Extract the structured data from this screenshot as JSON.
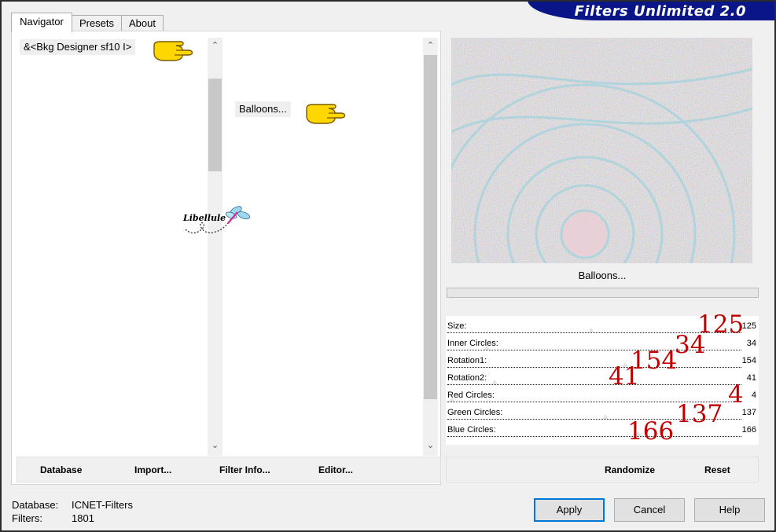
{
  "tabs": [
    "Navigator",
    "Presets",
    "About"
  ],
  "brand": "Filters Unlimited 2.0",
  "category_list": {
    "selected": "&<Bkg Designer sf10 I>"
  },
  "filter_list": {
    "selected": "Balloons..."
  },
  "watermark": "Libellule",
  "preview": {
    "filter_name": "Balloons..."
  },
  "parameters": [
    {
      "label": "Size:",
      "value": "125",
      "annotation": "125",
      "level": 125
    },
    {
      "label": "Inner Circles:",
      "value": "34",
      "annotation": "34",
      "level": 34
    },
    {
      "label": "Rotation1:",
      "value": "154",
      "annotation": "154",
      "level": 154
    },
    {
      "label": "Rotation2:",
      "value": "41",
      "annotation": "41",
      "level": 41
    },
    {
      "label": "Red Circles:",
      "value": "4",
      "annotation": "4",
      "level": 4
    },
    {
      "label": "Green Circles:",
      "value": "137",
      "annotation": "137",
      "level": 137
    },
    {
      "label": "Blue Circles:",
      "value": "166",
      "annotation": "166",
      "level": 166
    }
  ],
  "nav_buttons": {
    "database": "Database",
    "import": "Import...",
    "filter_info": "Filter Info...",
    "editor": "Editor..."
  },
  "param_buttons": {
    "randomize": "Randomize",
    "reset": "Reset"
  },
  "info": {
    "database_key": "Database:",
    "database_value": "ICNET-Filters",
    "filters_key": "Filters:",
    "filters_value": "1801"
  },
  "dialog_buttons": {
    "apply": "Apply",
    "cancel": "Cancel",
    "help": "Help"
  },
  "colors": {
    "brand_bg": "#0a1688",
    "annotation": "#c00000",
    "hand": "#ffd700",
    "apply_border": "#0078d7"
  }
}
